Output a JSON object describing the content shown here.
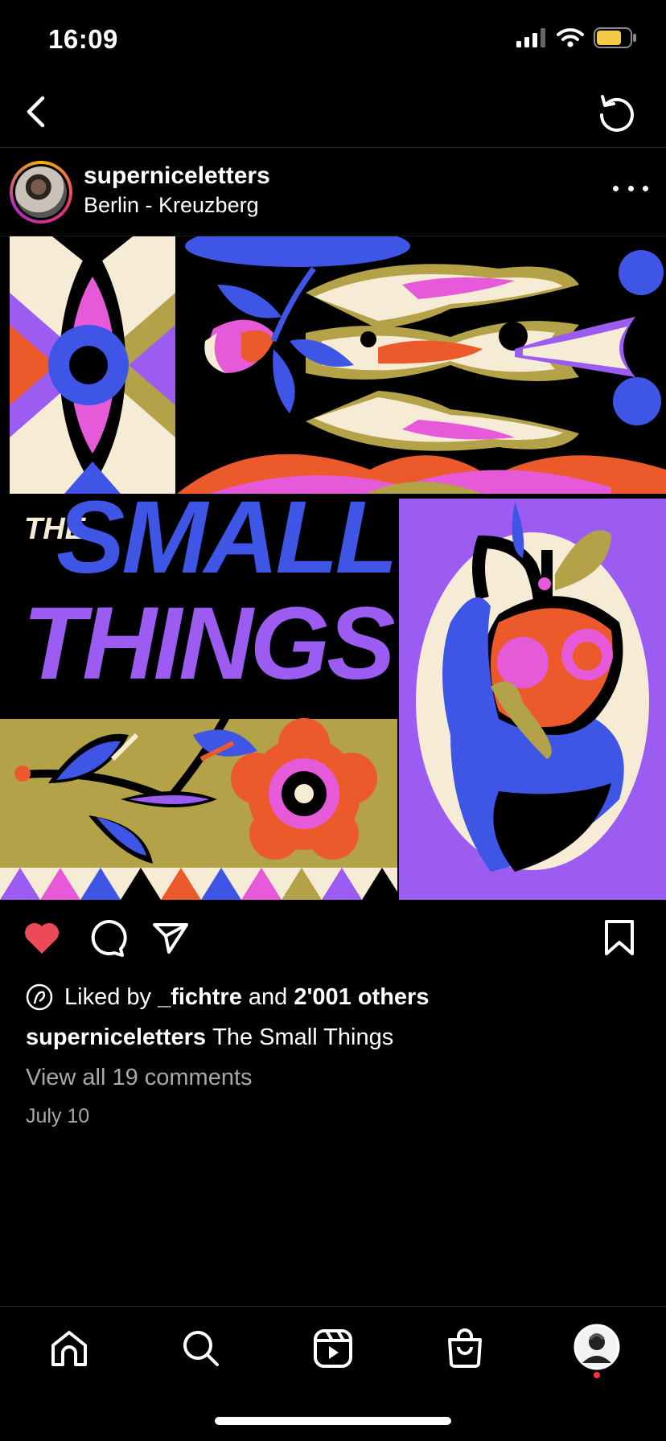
{
  "status_bar": {
    "time": "16:09",
    "battery_color": "#f5c847"
  },
  "nav": {
    "back_icon": "chevron-left-icon",
    "refresh_icon": "refresh-icon"
  },
  "post": {
    "username": "superniceletters",
    "location": "Berlin - Kreuzberg",
    "artwork": {
      "line1": "THE",
      "line2": "SMALL",
      "line3": "THINGS"
    },
    "liked_prefix": "Liked by",
    "liked_user": "_fichtre",
    "liked_and": "and",
    "liked_others": "2'001 others",
    "caption_user": "superniceletters",
    "caption_text": "The Small Things",
    "view_comments": "View all 19 comments",
    "date": "July 10"
  },
  "colors": {
    "like_red": "#ed4956",
    "muted_text": "#a8a8a8",
    "accent_blue": "#3f55e6",
    "accent_purple": "#9c5cf2",
    "accent_orange": "#ec5a2c",
    "accent_olive": "#b3a247",
    "accent_pink": "#e65ad9",
    "cream": "#f6ecd6"
  },
  "tab_bar": [
    "home-icon",
    "search-icon",
    "reels-icon",
    "shop-icon",
    "profile-avatar"
  ]
}
